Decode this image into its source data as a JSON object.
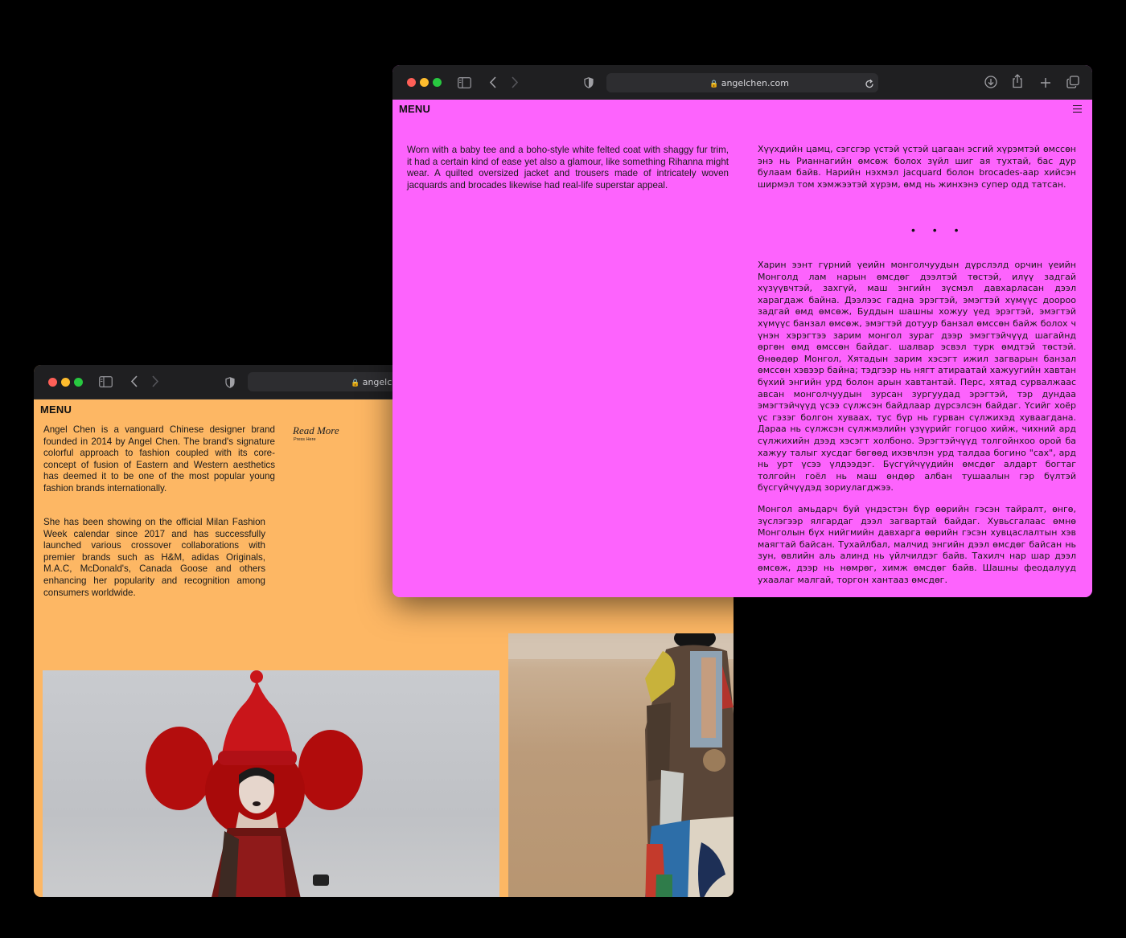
{
  "back_window": {
    "url": "angelchen.com",
    "menu_label": "MENU",
    "intro_paragraph": "Angel Chen is a vanguard Chinese designer brand founded in 2014 by Angel Chen. The brand's signature colorful approach to fashion coupled with its core-concept of fusion of Eastern and Western aesthetics has deemed it to be one of the most popular young fashion brands internationally.",
    "second_paragraph": "She has been showing on the official Milan Fashion Week calendar since 2017 and has successfully launched various crossover collaborations with premier brands such as H&M, adidas Originals, M.A.C, McDonald's, Canada Goose and others enhancing her popularity and recognition among consumers worldwide.",
    "read_more": "Read More",
    "press_here": "Press Here",
    "background_color": "#fdb764"
  },
  "front_window": {
    "url": "angelchen.com",
    "menu_label": "MENU",
    "english_paragraph": "Worn with a baby tee and a boho-style white felted coat with shaggy fur trim, it had a certain kind of ease yet also a glamour, like something Rihanna might wear. A quilted oversized jacket and trousers made of intricately woven jacquards and brocades likewise had real-life superstar appeal.",
    "mongolian_paragraph_1": "Хүүхдийн цамц, сэгсгэр үстэй үстэй цагаан эсгий хүрэмтэй өмссөн энэ нь Рианнагийн өмсөж болох зүйл шиг ая тухтай, бас дур булаам байв. Нарийн нэхмэл jacquard болон brocades-аар хийсэн ширмэл том хэмжээтэй хүрэм, өмд нь жинхэнэ супер одд  татсан.",
    "ellipsis": "• • •",
    "mongolian_paragraph_2": "Харин ээнт гүрний үеийн монголчуудын дүрслэлд орчин үеийн Монголд лам нарын өмсдөг дээлтэй төстэй, илүү задгай хүзүүвчтэй, захгүй, маш энгийн зүсмэл давхарласан дээл харагдаж байна. Дээлээс гадна эрэгтэй, эмэгтэй хүмүүс доороо задгай өмд өмсөж, Буддын шашны хожуу үед эрэгтэй, эмэгтэй хүмүүс банзал өмсөж, эмэгтэй дотуур банзал өмссөн байж болох ч үнэн хэрэгтээ зарим монгол зураг дээр эмэгтэйчүүд шагайнд өргөн өмд өмссөн байдаг. шалвар эсвэл турк өмдтэй төстэй. Өнөөдөр Монгол, Хятадын зарим хэсэгт ижил загварын банзал өмссөн хэвээр байна; тэдгээр нь нягт атираатай хажуугийн хавтан бүхий энгийн урд болон арын хавтантай. Перс, хятад сурвалжаас авсан монголчуудын зурсан зургуудад эрэгтэй, тэр дундаа эмэгтэйчүүд үсээ сүлжсэн байдлаар дүрсэлсэн байдаг. Үсийг хоёр үс гэзэг болгон хуваах, тус бүр нь гурван сүлжихэд хуваагдана. Дараа нь сүлжсэн сүлжмэлийн үзүүрийг гогцоо хийж, чихний ард сүлжихийн дээд хэсэгт холбоно. Эрэгтэйчүүд толгойнхоо орой ба хажуу талыг хусдаг бөгөөд ихэвчлэн урд талдаа богино \"сах\", ард нь урт үсээ үлдээдэг. Бүсгүйчүүдийн өмсдөг алдарт богтаг толгойн гоёл нь маш өндөр албан тушаалын гэр бүлтэй бүсгүйчүүдэд зориулагджээ.",
    "mongolian_paragraph_3": "Монгол амьдарч буй үндэстэн бүр өөрийн гэсэн тайралт, өнгө, зүслэгээр ялгардаг дээл загвартай байдаг. Хувьсгалаас өмнө Монголын бүх нийгмийн давхарга өөрийн гэсэн хувцаслалтын хэв маягтай байсан. Тухайлбал, малчид энгийн дээл өмсдөг байсан нь зун, өвлийн аль алинд нь үйлчилдэг байв. Тахилч нар шар дээл өмсөж, дээр нь нөмрөг, химж өмсдөг байв. Шашны феодалууд ухаалаг малгай, торгон хантааз өмсдөг.",
    "background_color": "#fd63fd"
  },
  "icons": [
    "close-dot",
    "minimize-dot",
    "zoom-dot",
    "sidebar-icon",
    "back-arrow-icon",
    "forward-arrow-icon",
    "shield-icon",
    "lock-icon",
    "reload-icon",
    "download-icon",
    "share-icon",
    "new-tab-icon",
    "tabs-overview-icon",
    "hamburger-icon"
  ]
}
